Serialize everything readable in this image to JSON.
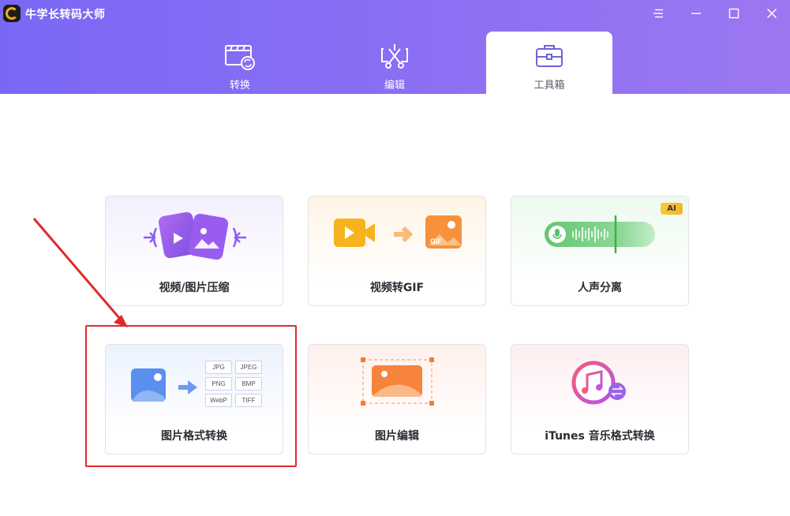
{
  "app": {
    "title": "牛学长转码大师",
    "accent": "#8a6ef3"
  },
  "window_controls": [
    {
      "name": "menu-icon"
    },
    {
      "name": "minimize-icon"
    },
    {
      "name": "maximize-icon"
    },
    {
      "name": "close-icon"
    }
  ],
  "tabs": [
    {
      "label": "转换",
      "icon": "video-convert-icon",
      "active": false
    },
    {
      "label": "编辑",
      "icon": "video-edit-icon",
      "active": false
    },
    {
      "label": "工具箱",
      "icon": "toolbox-icon",
      "active": true
    }
  ],
  "tools": [
    {
      "label": "视频/图片压缩",
      "icon": "compress-icon"
    },
    {
      "label": "视频转GIF",
      "icon": "video-to-gif-icon"
    },
    {
      "label": "人声分离",
      "icon": "voice-separation-icon",
      "badge": "AI"
    },
    {
      "label": "图片格式转换",
      "icon": "image-format-convert-icon",
      "formats": [
        "JPG",
        "JPEG",
        "PNG",
        "BMP",
        "WebP",
        "TIFF"
      ]
    },
    {
      "label": "图片编辑",
      "icon": "image-edit-icon"
    },
    {
      "label": "iTunes 音乐格式转换",
      "icon": "itunes-convert-icon"
    }
  ],
  "annotation": {
    "highlight_color": "#e02a2a"
  }
}
